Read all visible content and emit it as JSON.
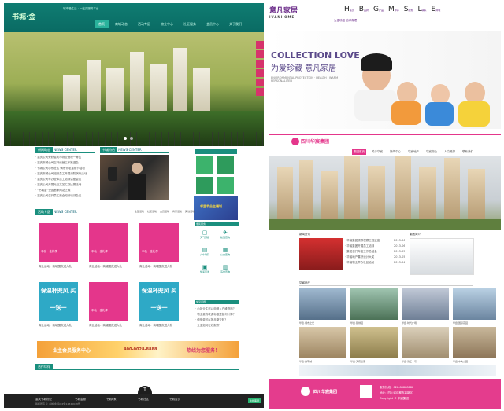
{
  "left": {
    "logo_cn": "书城·金",
    "logo_tag": "城市慢生活 · 一站式服务平台",
    "nav": [
      "首页",
      "商城动态",
      "活动专区",
      "物业中心",
      "社区服务",
      "会员中心",
      "关于我们"
    ],
    "news_tag": "新闻动态",
    "news_en": "NEWS CENTER",
    "news_items": [
      "· 重庆公司荣获重庆市物业管理一等奖",
      "· 重庆书城公司召开经营工作推进会",
      "· 书城公司心系社区 情系邻里重阳节活动",
      "· 重庆书城公司组织员工开展消防演练活动",
      "· 重庆公司举办全体员工培训讲座会议",
      "· 重庆公司开展元旦文艺汇演比赛活动",
      "· “书城金”全国首家网站上线",
      "· 重庆公司召开员工安全知识培训会议"
    ],
    "feature_tag": "书城特色",
    "feature_en": "NEWS CENTER",
    "tab_tag": "活动专区",
    "tab_en": "NEWS CENTER",
    "tabs": [
      "全部活动",
      "社区活动",
      "会员活动",
      "商家活动",
      "其他活动"
    ],
    "cards": [
      {
        "title": "中秋 · 佳礼享",
        "cap": "商业活动：商城国庆送大礼"
      },
      {
        "title": "中秋 · 佳礼享",
        "cap": "商业活动：商城国庆送大礼"
      },
      {
        "title": "中秋 · 佳礼享",
        "cap": "商业活动：商城国庆送大礼"
      }
    ],
    "teal_cards": [
      {
        "title": "保温杯兜风 买一送一",
        "cap": "商业活动：商城国庆送大礼"
      },
      {
        "title": "保温杯兜风 买一送一",
        "cap": "商业活动：商城国庆送大礼"
      }
    ],
    "services_tag": "便民服务",
    "services": [
      "在线报修",
      "投诉建议",
      "业主论坛",
      "在线缴费"
    ],
    "promo": "邻里节业主福利",
    "quick_tag": "快捷通道",
    "quick": [
      "天气预报",
      "航班查询",
      "火车时刻",
      "公交查询",
      "快递查询",
      "违章查询"
    ],
    "notice_tag": "常见问题",
    "notice_items": [
      "· 小区业主可以申请入户维修吗？",
      "· 物业费的收费标准是如何计算？",
      "· 停车费可以按月缴交吗？",
      "· 业主如何在线报修？"
    ],
    "banner_left": "业主会员服务中心",
    "banner_phone": "400-0028-8888",
    "banner_right": "热线为您服务！",
    "partner_tag": "合作伙伴",
    "footer": [
      "重庆书城物业",
      "书城金服",
      "书城e家",
      "书城社区",
      "书城会员"
    ],
    "footer_copy": "版权所有 © 书城·金 渝ICP备12345678号",
    "footer_badge": "在线客服"
  },
  "right_top": {
    "logo": "意凡家居",
    "logo_en": "IVANHOME",
    "menu": [
      {
        "letter": "H",
        "label": "首页"
      },
      {
        "letter": "B",
        "label": "品牌"
      },
      {
        "letter": "G",
        "label": "产品"
      },
      {
        "letter": "M",
        "label": "中心"
      },
      {
        "letter": "S",
        "label": "服务"
      },
      {
        "letter": "L",
        "label": "联系"
      },
      {
        "letter": "E",
        "label": "商城"
      }
    ],
    "slogan": "为爱珍藏 追求真理",
    "collection": "COLLECTION LOVE",
    "collection_cn": "为爱珍藏    意凡家居",
    "env": "ENVIRONMENTAL PROTECTION · HEALTH · WARM PERSONALIZED"
  },
  "right_bottom": {
    "logo": "四川华宸集团",
    "nav": [
      "集团首页",
      "关于华宸",
      "新闻中心",
      "华宸地产",
      "华宸物业",
      "人力资源",
      "联系我们"
    ],
    "news_title": "新闻资讯",
    "news_items": [
      "· 华宸集团领导视察工程进度",
      "· 华宸集团开展员工培训",
      "· 集团召开年度工作总结会",
      "· 华宸地产喜获设计大奖",
      "· 华宸物业举办社区活动",
      "· 集团召开年终表彰大会",
      "· 华宸荣获年度优秀企业称号"
    ],
    "date_items": [
      "2013-06",
      "2013-06",
      "2013-05",
      "2013-05",
      "2013-04",
      "2013-04",
      "2013-03"
    ],
    "right_title": "集团简介",
    "estate_title": "华宸地产",
    "thumb_caps": [
      "华宸·城市之光",
      "华宸·锦绣园",
      "华宸·时代广场",
      "华宸·国际花园",
      "华宸·翡翠城",
      "华宸·天府世家",
      "华宸·滨江一号",
      "华宸·中央公园"
    ],
    "footer_logo": "四川华宸集团",
    "footer_phone": "服务热线：028-88888888",
    "footer_addr": "地址：四川省成都市高新区",
    "footer_copy": "Copyright © 华宸集团"
  }
}
